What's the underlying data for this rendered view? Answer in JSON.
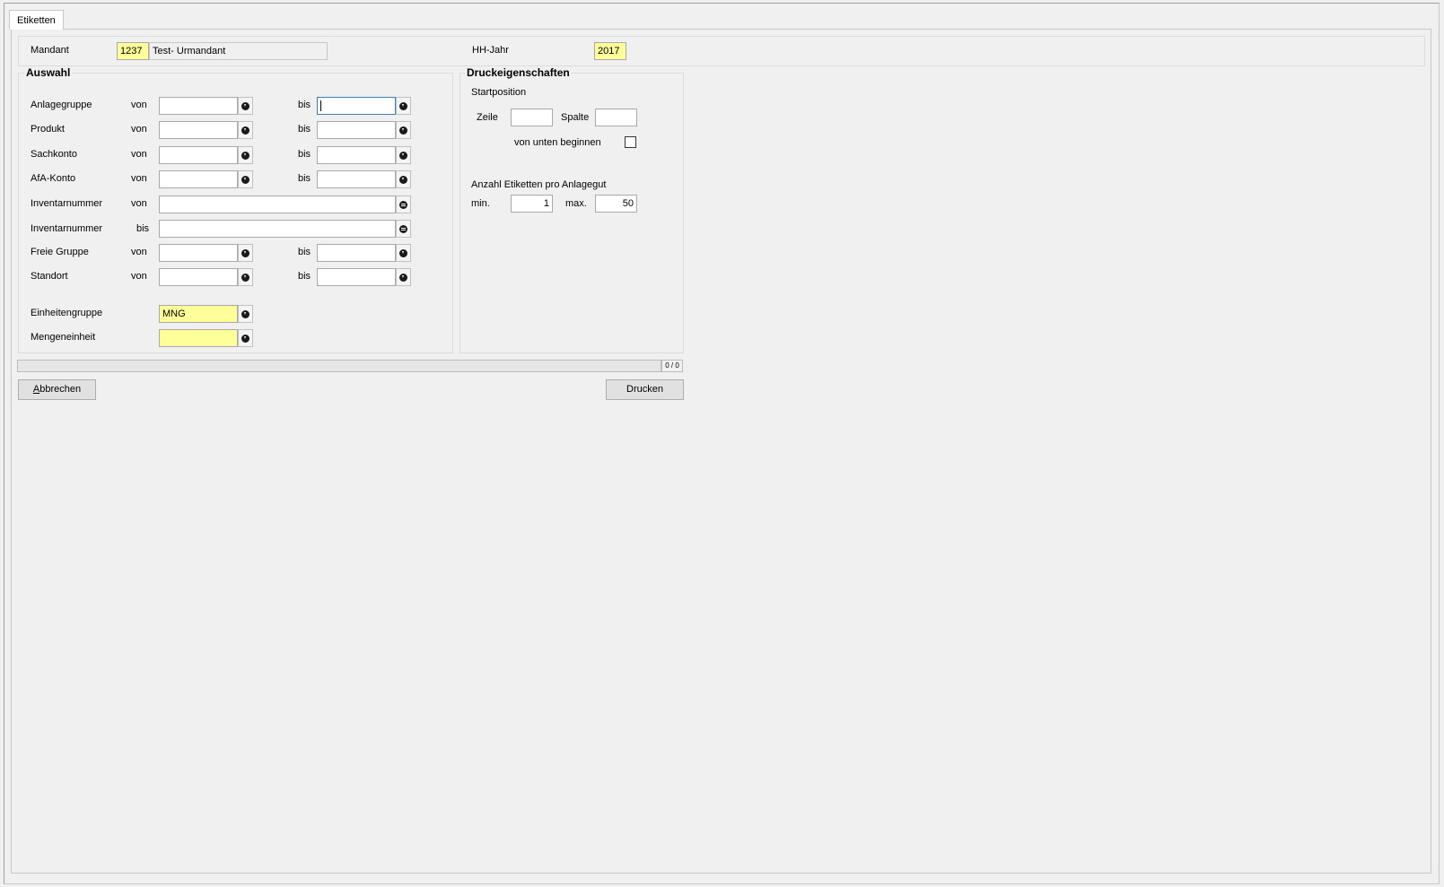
{
  "tab": {
    "label": "Etiketten"
  },
  "header": {
    "mandant_label": "Mandant",
    "mandant_code": "1237",
    "mandant_name": "Test- Urmandant",
    "hhjahr_label": "HH-Jahr",
    "hhjahr_value": "2017"
  },
  "auswahl": {
    "title": "Auswahl",
    "von_label": "von",
    "bis_label": "bis",
    "rows": [
      {
        "label": "Anlagegruppe",
        "von_value": "",
        "bis_value": ""
      },
      {
        "label": "Produkt",
        "von_value": "",
        "bis_value": ""
      },
      {
        "label": "Sachkonto",
        "von_value": "",
        "bis_value": ""
      },
      {
        "label": "AfA-Konto",
        "von_value": "",
        "bis_value": ""
      },
      {
        "label": "Inventarnummer",
        "sub_label": "von",
        "value": ""
      },
      {
        "label": "Inventarnummer",
        "sub_label": "bis",
        "value": ""
      },
      {
        "label": "Freie Gruppe",
        "von_value": "",
        "bis_value": ""
      },
      {
        "label": "Standort",
        "von_value": "",
        "bis_value": ""
      }
    ],
    "einheitengruppe": {
      "label": "Einheitengruppe",
      "value": "MNG"
    },
    "mengeneinheit": {
      "label": "Mengeneinheit",
      "value": ""
    }
  },
  "druck": {
    "title": "Druckeigenschaften",
    "startposition_label": "Startposition",
    "zeile_label": "Zeile",
    "zeile_value": "",
    "spalte_label": "Spalte",
    "spalte_value": "",
    "von_unten_label": "von unten beginnen",
    "von_unten_checked": false,
    "anzahl_label": "Anzahl Etiketten pro Anlagegut",
    "min_label": "min.",
    "min_value": "1",
    "max_label": "max.",
    "max_value": "50"
  },
  "progress": {
    "fraction": 0,
    "count_text": "0 / 0",
    "fill_color": "#06b025"
  },
  "buttons": {
    "cancel_label": "Abbrechen",
    "print_label": "Drucken"
  },
  "colors": {
    "required_field": "#ffff99",
    "focus_border": "#3c7fb1"
  },
  "icons": {
    "lookup": "lookup-dot-icon",
    "equals": "equals-dot-icon"
  }
}
